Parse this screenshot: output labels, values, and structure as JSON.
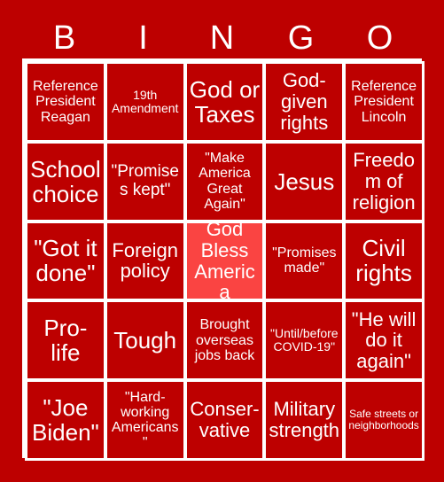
{
  "card": {
    "title": "BINGO",
    "header_letters": [
      "B",
      "I",
      "N",
      "G",
      "O"
    ],
    "colors": {
      "background": "#bd0000",
      "cell": "#bd0000",
      "free_cell": "#fa4442",
      "grid_line": "#ffffff",
      "text": "#ffffff"
    },
    "rows": [
      [
        {
          "text": "Reference President Reagan",
          "size": "md",
          "marked": false
        },
        {
          "text": "19th Amendment",
          "size": "sm",
          "marked": false
        },
        {
          "text": "God or Taxes",
          "size": "xxl",
          "marked": false
        },
        {
          "text": "God-given rights",
          "size": "xl",
          "marked": false
        },
        {
          "text": "Reference President Lincoln",
          "size": "md",
          "marked": false
        }
      ],
      [
        {
          "text": "School choice",
          "size": "xxl",
          "marked": false
        },
        {
          "text": "\"Promises kept\"",
          "size": "lg",
          "marked": false
        },
        {
          "text": "\"Make America Great Again\"",
          "size": "md",
          "marked": false
        },
        {
          "text": "Jesus",
          "size": "xxl",
          "marked": false
        },
        {
          "text": "Freedom of religion",
          "size": "xl",
          "marked": false
        }
      ],
      [
        {
          "text": "\"Got it done\"",
          "size": "xxl",
          "marked": false
        },
        {
          "text": "Foreign policy",
          "size": "xl",
          "marked": false
        },
        {
          "text": "God Bless America",
          "size": "xl",
          "marked": true
        },
        {
          "text": "\"Promises made\"",
          "size": "md",
          "marked": false
        },
        {
          "text": "Civil rights",
          "size": "xxl",
          "marked": false
        }
      ],
      [
        {
          "text": "Pro-life",
          "size": "xxl",
          "marked": false
        },
        {
          "text": "Tough",
          "size": "xxl",
          "marked": false
        },
        {
          "text": "Brought overseas jobs back",
          "size": "md",
          "marked": false
        },
        {
          "text": "\"Until/before COVID-19\"",
          "size": "sm",
          "marked": false
        },
        {
          "text": "\"He will do it again\"",
          "size": "xl",
          "marked": false
        }
      ],
      [
        {
          "text": "\"Joe Biden\"",
          "size": "xxl",
          "marked": false
        },
        {
          "text": "\"Hard-working Americans\"",
          "size": "md",
          "marked": false
        },
        {
          "text": "Conser-vative",
          "size": "xl",
          "marked": false
        },
        {
          "text": "Military strength",
          "size": "xl",
          "marked": false
        },
        {
          "text": "Safe streets or neighborhoods",
          "size": "xs",
          "marked": false
        }
      ]
    ]
  }
}
